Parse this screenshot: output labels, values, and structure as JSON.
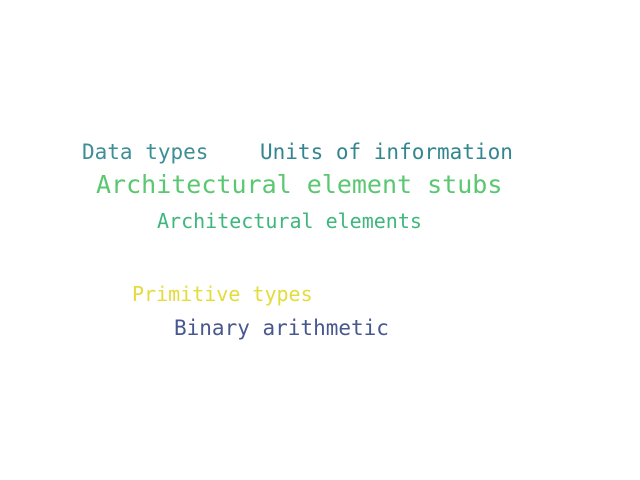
{
  "words": [
    {
      "text": "Data types",
      "color": "#3e8e97"
    },
    {
      "text": "Units of information",
      "color": "#33868f"
    },
    {
      "text": "Architectural element stubs",
      "color": "#5bc770"
    },
    {
      "text": "Architectural elements",
      "color": "#3fb77c"
    },
    {
      "text": "Primitive types",
      "color": "#e3dc3a"
    },
    {
      "text": "Binary arithmetic",
      "color": "#48578e"
    }
  ]
}
